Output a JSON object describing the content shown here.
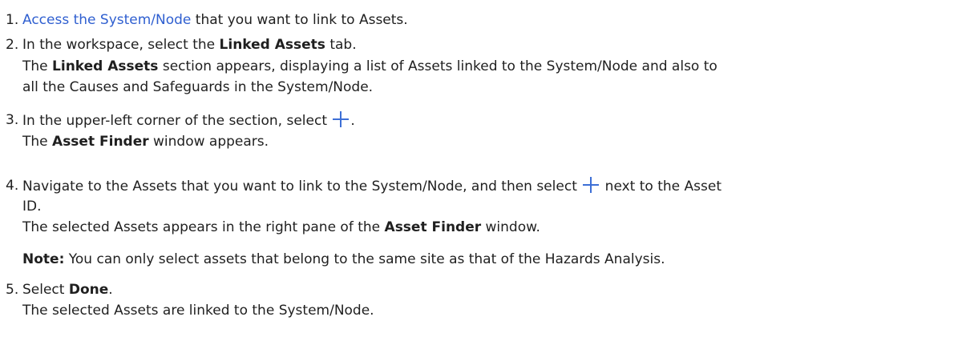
{
  "steps": [
    {
      "number": "1.",
      "link_text": "Access the System/Node",
      "text_after": " that you want to link to Assets."
    },
    {
      "number": "2.",
      "text_before": "In the workspace, select the ",
      "bold": "Linked Assets",
      "text_after": " tab.",
      "result_before": "The ",
      "result_bold": "Linked Assets",
      "result_after_line1": " section appears, displaying a list of Assets linked to the System/Node and also to",
      "result_line2": "all the Causes and Safeguards in the System/Node."
    },
    {
      "number": "3.",
      "text_before": "In the upper-left corner of the section, select ",
      "text_after": ".",
      "icon": "plus-icon",
      "result_before": "The ",
      "result_bold": "Asset Finder",
      "result_after": " window appears."
    },
    {
      "number": "4.",
      "text_before": "Navigate to the Assets that you want to link to the System/Node, and then select ",
      "text_after": " next to the Asset",
      "text_line2": "ID.",
      "icon": "plus-icon",
      "result_before": "The selected Assets appears in the right pane of the ",
      "result_bold": "Asset Finder",
      "result_after": " window.",
      "note_label": "Note:",
      "note_text": " You can only select assets that belong to the same site as that of the Hazards Analysis."
    },
    {
      "number": "5.",
      "text_before": "Select ",
      "bold": "Done",
      "text_after": ".",
      "result": "The selected Assets are linked to the System/Node."
    }
  ],
  "colors": {
    "link": "#2f5fd0",
    "icon": "#3d6fd6",
    "text": "#1f1f1f"
  }
}
